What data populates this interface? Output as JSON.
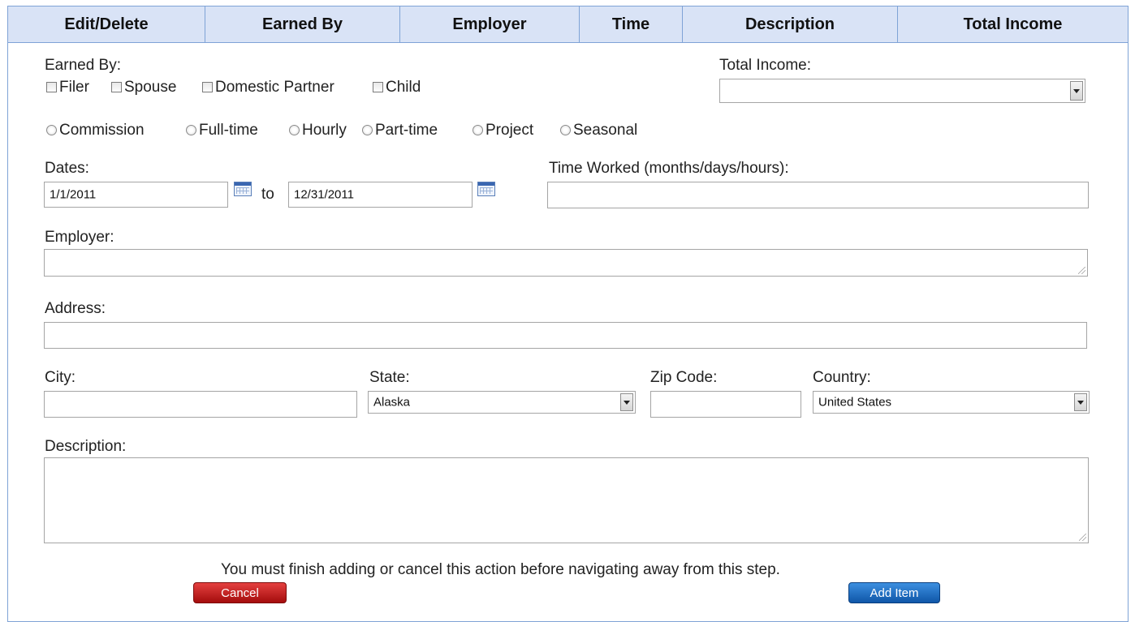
{
  "header": {
    "columns": [
      "Edit/Delete",
      "Earned By",
      "Employer",
      "Time",
      "Description",
      "Total Income"
    ]
  },
  "earned_by": {
    "label": "Earned By:",
    "options": [
      "Filer",
      "Spouse",
      "Domestic Partner",
      "Child"
    ]
  },
  "total_income": {
    "label": "Total Income:",
    "value": ""
  },
  "employment_type": {
    "options": [
      "Commission",
      "Full-time",
      "Hourly",
      "Part-time",
      "Project",
      "Seasonal"
    ]
  },
  "dates": {
    "label": "Dates:",
    "from": "1/1/2011",
    "to_label": "to",
    "to": "12/31/2011"
  },
  "time_worked": {
    "label": "Time Worked (months/days/hours):",
    "value": ""
  },
  "employer": {
    "label": "Employer:",
    "value": ""
  },
  "address": {
    "label": "Address:",
    "value": ""
  },
  "city": {
    "label": "City:",
    "value": ""
  },
  "state": {
    "label": "State:",
    "value": "Alaska"
  },
  "zip": {
    "label": "Zip Code:",
    "value": ""
  },
  "country": {
    "label": "Country:",
    "value": "United States"
  },
  "description": {
    "label": "Description:",
    "value": ""
  },
  "notice": "You must finish adding or cancel this action before navigating away from this step.",
  "buttons": {
    "cancel": "Cancel",
    "add": "Add Item"
  }
}
